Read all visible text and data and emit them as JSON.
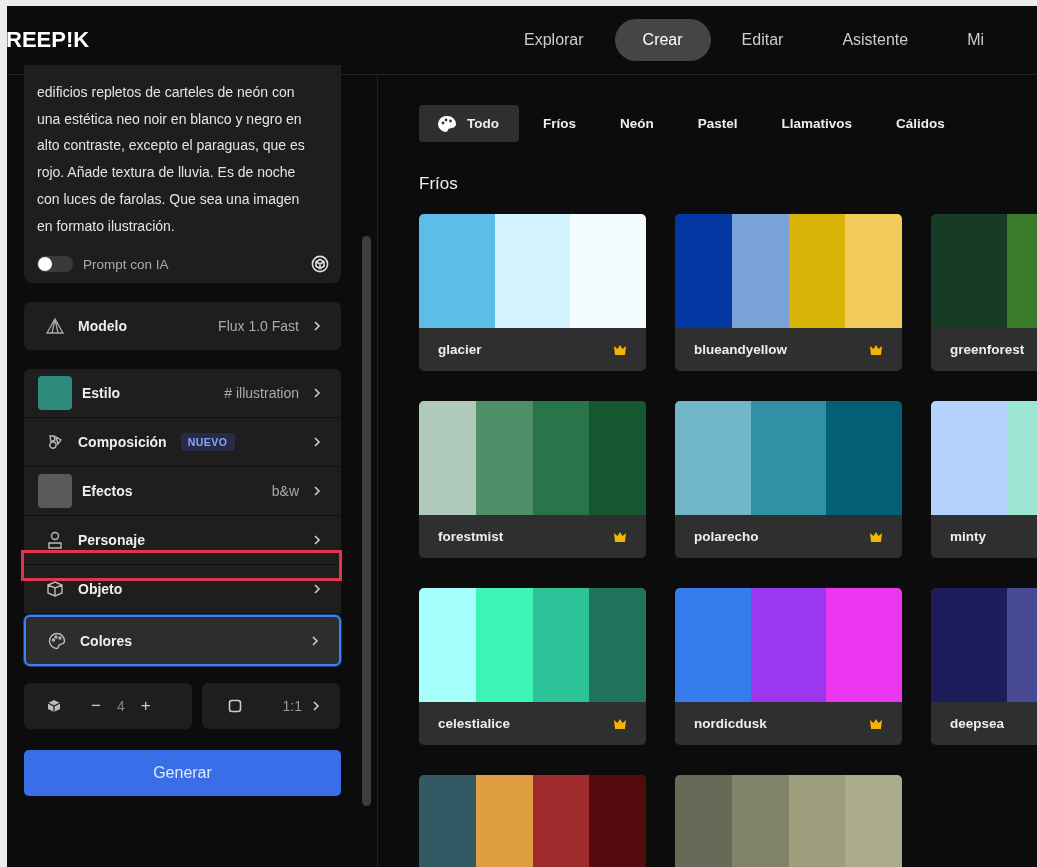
{
  "header": {
    "logo": "REEP!K",
    "nav": [
      {
        "label": "Explorar",
        "selected": false
      },
      {
        "label": "Crear",
        "selected": true
      },
      {
        "label": "Editar",
        "selected": false
      },
      {
        "label": "Asistente",
        "selected": false
      },
      {
        "label": "Mi",
        "selected": false
      }
    ]
  },
  "sidebar": {
    "prompt": {
      "value": "edificios repletos de carteles de neón con una estética neo noir en blanco y negro en alto contraste, excepto el paraguas, que es rojo. Añade textura de lluvia. Es de noche con luces de farolas. Que sea una imagen en formato ilustración.",
      "ai_toggle": {
        "label": "Prompt con IA",
        "on": false
      }
    },
    "model": {
      "label": "Modelo",
      "value": "Flux 1.0 Fast"
    },
    "options": [
      {
        "kind": "thumbnail",
        "label": "Estilo",
        "value": "# illustration",
        "selected": false
      },
      {
        "kind": "icon",
        "label": "Composición",
        "badge": "NUEVO",
        "selected": false
      },
      {
        "kind": "thumbnail",
        "label": "Efectos",
        "value": "b&w",
        "selected": false
      },
      {
        "kind": "icon",
        "label": "Personaje",
        "selected": false
      },
      {
        "kind": "icon",
        "label": "Objeto",
        "selected": false
      },
      {
        "kind": "icon",
        "label": "Colores",
        "selected": true
      }
    ],
    "count": {
      "minus": "−",
      "value": "4",
      "plus": "+"
    },
    "ratio": {
      "value": "1:1"
    },
    "generate_button": "Generar"
  },
  "main": {
    "filters": [
      {
        "label": "Todo",
        "selected": true
      },
      {
        "label": "Fríos",
        "selected": false
      },
      {
        "label": "Neón",
        "selected": false
      },
      {
        "label": "Pastel",
        "selected": false
      },
      {
        "label": "Llamativos",
        "selected": false
      },
      {
        "label": "Cálidos",
        "selected": false
      }
    ],
    "section_title": "Fríos",
    "palettes": [
      {
        "name": "glacier",
        "premium": true,
        "swatches": [
          {
            "color": "#5bbde8"
          },
          {
            "color": "#d3f3fe"
          },
          {
            "color": "#f3fbff"
          }
        ]
      },
      {
        "name": "blueandyellow",
        "premium": true,
        "swatches": [
          {
            "color": "#0338a3"
          },
          {
            "color": "#7ba3d8"
          },
          {
            "color": "#d8b308"
          },
          {
            "color": "#f1cb5b"
          }
        ]
      },
      {
        "name": "greenforest",
        "premium": false,
        "swatches": [
          {
            "color": "#163a23"
          },
          {
            "color": "#3b7a2b"
          }
        ]
      },
      {
        "name": "forestmist",
        "premium": true,
        "swatches": [
          {
            "color": "#afc9bb"
          },
          {
            "color": "#4f8f68"
          },
          {
            "color": "#287549"
          },
          {
            "color": "#15582f"
          }
        ]
      },
      {
        "name": "polarecho",
        "premium": true,
        "swatches": [
          {
            "color": "#71b7c7"
          },
          {
            "color": "#3190a4"
          },
          {
            "color": "#035f75"
          }
        ]
      },
      {
        "name": "minty",
        "premium": false,
        "swatches": [
          {
            "color": "#b3d2fd"
          },
          {
            "color": "#9de6d3"
          }
        ]
      },
      {
        "name": "celestialice",
        "premium": true,
        "swatches": [
          {
            "color": "#a7fffb"
          },
          {
            "color": "#3ef3b6"
          },
          {
            "color": "#2cc398"
          },
          {
            "color": "#22735b"
          }
        ]
      },
      {
        "name": "nordicdusk",
        "premium": true,
        "swatches": [
          {
            "color": "#377cef"
          },
          {
            "color": "#9b37ef"
          },
          {
            "color": "#eb37ef"
          }
        ]
      },
      {
        "name": "deepsea",
        "premium": false,
        "swatches": [
          {
            "color": "#1e1d5c"
          },
          {
            "color": "#474993"
          }
        ]
      },
      {
        "swatches": [
          {
            "color": "#335a64"
          },
          {
            "color": "#e09e42"
          },
          {
            "color": "#a02b2c"
          },
          {
            "color": "#540b0e"
          }
        ]
      },
      {
        "swatches": [
          {
            "color": "#686a58"
          },
          {
            "color": "#808269"
          },
          {
            "color": "#9c9e7c"
          },
          {
            "color": "#aaac8c"
          }
        ]
      }
    ]
  },
  "annotation": {
    "highlight": true
  }
}
